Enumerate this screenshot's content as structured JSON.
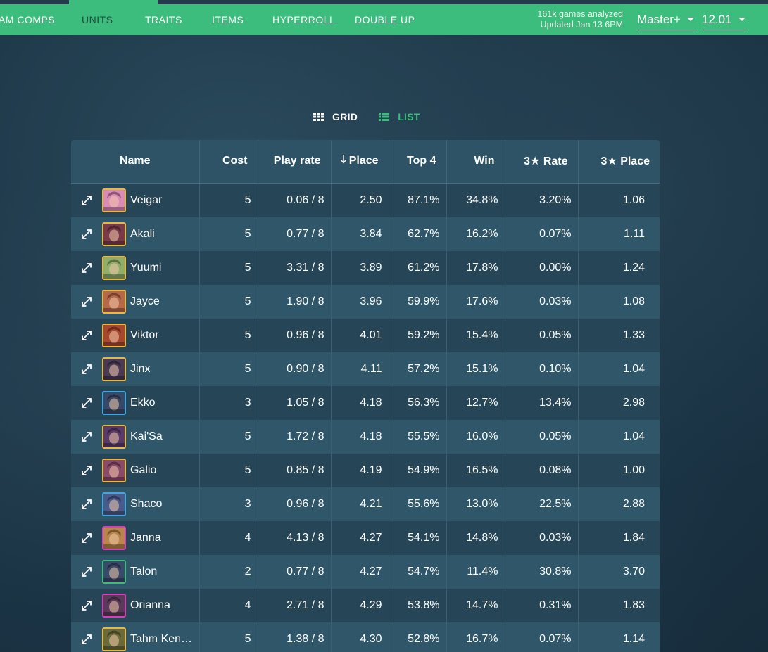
{
  "nav": {
    "items": [
      {
        "label": "AM COMPS",
        "active": false
      },
      {
        "label": "UNITS",
        "active": true
      },
      {
        "label": "TRAITS",
        "active": false
      },
      {
        "label": "ITEMS",
        "active": false
      },
      {
        "label": "HYPERROLL",
        "active": false
      },
      {
        "label": "DOUBLE UP",
        "active": false
      }
    ],
    "games_analyzed": "161k games analyzed",
    "updated": "Updated Jan 13 6PM",
    "rank_filter": "Master+",
    "patch": "12.01"
  },
  "view_toggle": {
    "grid_label": "GRID",
    "list_label": "LIST",
    "active": "list"
  },
  "table": {
    "headers": [
      "Name",
      "Cost",
      "Play rate",
      "Place",
      "Top 4",
      "Win",
      "3★ Rate",
      "3★ Place"
    ],
    "sorted_by": "Place",
    "rows": [
      {
        "name": "Veigar",
        "cost": "5",
        "play_rate": "0.06 / 8",
        "place": "2.50",
        "top4": "87.1%",
        "win": "34.8%",
        "star3_rate": "3.20%",
        "star3_place": "1.06",
        "border": "#e9b83c",
        "tint": "#d98ab5"
      },
      {
        "name": "Akali",
        "cost": "5",
        "play_rate": "0.77 / 8",
        "place": "3.84",
        "top4": "62.7%",
        "win": "16.2%",
        "star3_rate": "0.07%",
        "star3_place": "1.11",
        "border": "#e9b83c",
        "tint": "#7a3a4a"
      },
      {
        "name": "Yuumi",
        "cost": "5",
        "play_rate": "3.31 / 8",
        "place": "3.89",
        "top4": "61.2%",
        "win": "17.8%",
        "star3_rate": "0.00%",
        "star3_place": "1.24",
        "border": "#e9b83c",
        "tint": "#8fae6a"
      },
      {
        "name": "Jayce",
        "cost": "5",
        "play_rate": "1.90 / 8",
        "place": "3.96",
        "top4": "59.9%",
        "win": "17.6%",
        "star3_rate": "0.03%",
        "star3_place": "1.08",
        "border": "#e9b83c",
        "tint": "#b5684a"
      },
      {
        "name": "Viktor",
        "cost": "5",
        "play_rate": "0.96 / 8",
        "place": "4.01",
        "top4": "59.2%",
        "win": "15.4%",
        "star3_rate": "0.05%",
        "star3_place": "1.33",
        "border": "#e9b83c",
        "tint": "#a8472f"
      },
      {
        "name": "Jinx",
        "cost": "5",
        "play_rate": "0.90 / 8",
        "place": "4.11",
        "top4": "57.2%",
        "win": "15.1%",
        "star3_rate": "0.10%",
        "star3_place": "1.04",
        "border": "#e9b83c",
        "tint": "#4a3a55"
      },
      {
        "name": "Ekko",
        "cost": "3",
        "play_rate": "1.05 / 8",
        "place": "4.18",
        "top4": "56.3%",
        "win": "12.7%",
        "star3_rate": "13.4%",
        "star3_place": "2.98",
        "border": "#3ea7e0",
        "tint": "#3a4868"
      },
      {
        "name": "Kai'Sa",
        "cost": "5",
        "play_rate": "1.72 / 8",
        "place": "4.18",
        "top4": "55.5%",
        "win": "16.0%",
        "star3_rate": "0.05%",
        "star3_place": "1.04",
        "border": "#e9b83c",
        "tint": "#5a3a6a"
      },
      {
        "name": "Galio",
        "cost": "5",
        "play_rate": "0.85 / 8",
        "place": "4.19",
        "top4": "54.9%",
        "win": "16.5%",
        "star3_rate": "0.08%",
        "star3_place": "1.00",
        "border": "#e9b83c",
        "tint": "#8a4a6a"
      },
      {
        "name": "Shaco",
        "cost": "3",
        "play_rate": "0.96 / 8",
        "place": "4.21",
        "top4": "55.6%",
        "win": "13.0%",
        "star3_rate": "22.5%",
        "star3_place": "2.88",
        "border": "#3ea7e0",
        "tint": "#4a5a8a"
      },
      {
        "name": "Janna",
        "cost": "4",
        "play_rate": "4.13 / 8",
        "place": "4.27",
        "top4": "54.1%",
        "win": "14.8%",
        "star3_rate": "0.03%",
        "star3_place": "1.84",
        "border": "#d63fb6",
        "tint": "#b8854a"
      },
      {
        "name": "Talon",
        "cost": "2",
        "play_rate": "0.77 / 8",
        "place": "4.27",
        "top4": "54.7%",
        "win": "11.4%",
        "star3_rate": "30.8%",
        "star3_place": "3.70",
        "border": "#3dbd7d",
        "tint": "#3a4a6a"
      },
      {
        "name": "Orianna",
        "cost": "4",
        "play_rate": "2.71 / 8",
        "place": "4.29",
        "top4": "53.8%",
        "win": "14.7%",
        "star3_rate": "0.31%",
        "star3_place": "1.83",
        "border": "#d63fb6",
        "tint": "#5a3a5a"
      },
      {
        "name": "Tahm Ken…",
        "cost": "5",
        "play_rate": "1.38 / 8",
        "place": "4.30",
        "top4": "52.8%",
        "win": "16.7%",
        "star3_rate": "0.07%",
        "star3_place": "1.14",
        "border": "#e9b83c",
        "tint": "#6a6a3a"
      }
    ]
  }
}
